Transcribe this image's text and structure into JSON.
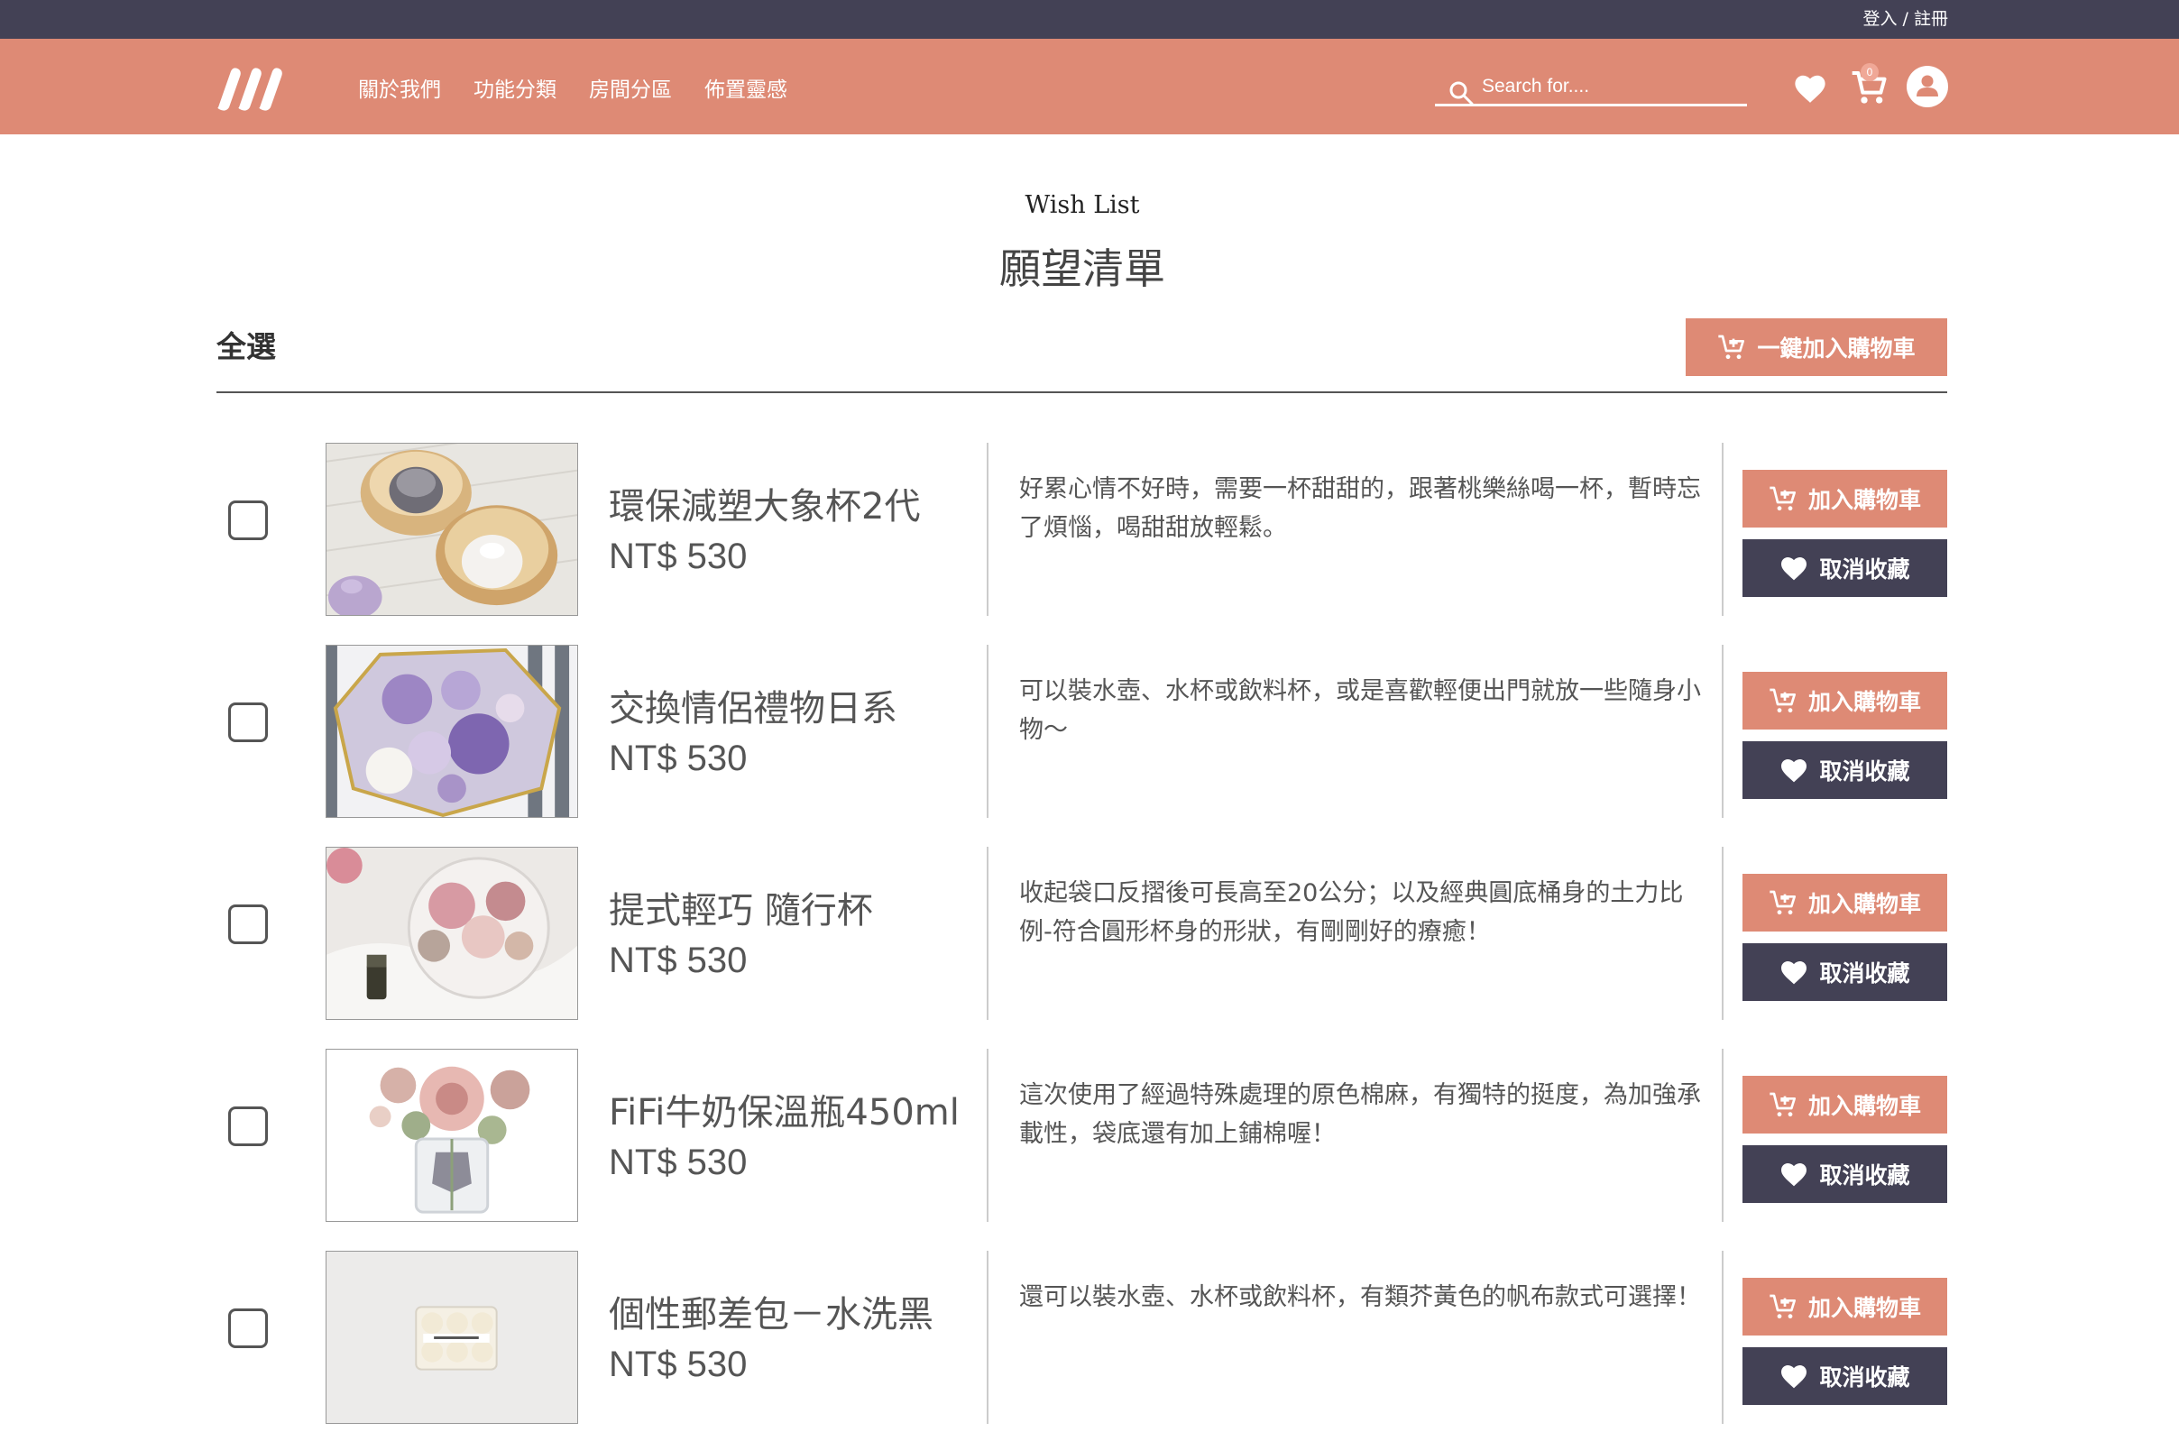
{
  "topbar": {
    "login": "登入",
    "separator": "/",
    "register": "註冊"
  },
  "nav": {
    "links": [
      "關於我們",
      "功能分類",
      "房間分區",
      "佈置靈感"
    ],
    "search_placeholder": "Search for....",
    "cart_count": "0"
  },
  "page": {
    "title_en": "Wish List",
    "title_zh": "願望清單",
    "select_all": "全選",
    "add_all_label": "一鍵加入購物車"
  },
  "items": [
    {
      "name": "環保減塑大象杯2代",
      "price": "NT$ 530",
      "description": "好累心情不好時，需要一杯甜甜的，跟著桃樂絲喝一杯，暫時忘了煩惱，喝甜甜放輕鬆。",
      "add_label": "加入購物車",
      "remove_label": "取消收藏"
    },
    {
      "name": "交換情侶禮物日系",
      "price": "NT$ 530",
      "description": "可以裝水壺、水杯或飲料杯，或是喜歡輕便出門就放一些隨身小物～",
      "add_label": "加入購物車",
      "remove_label": "取消收藏"
    },
    {
      "name": "提式輕巧 隨行杯",
      "price": "NT$ 530",
      "description": "收起袋口反摺後可長高至20公分；以及經典圓底桶身的土力比例-符合圓形杯身的形狀，有剛剛好的療癒！",
      "add_label": "加入購物車",
      "remove_label": "取消收藏"
    },
    {
      "name": "FiFi牛奶保溫瓶450ml",
      "price": "NT$ 530",
      "description": "這次使用了經過特殊處理的原色棉麻，有獨特的挺度，為加強承載性，袋底還有加上鋪棉喔！",
      "add_label": "加入購物車",
      "remove_label": "取消收藏"
    },
    {
      "name": "個性郵差包－水洗黑",
      "price": "NT$ 530",
      "description": "還可以裝水壺、水杯或飲料杯，有類芥黃色的帆布款式可選擇！",
      "add_label": "加入購物車",
      "remove_label": "取消收藏"
    }
  ],
  "colors": {
    "accent": "#de8a75",
    "dark": "#434155",
    "text": "#555555"
  }
}
